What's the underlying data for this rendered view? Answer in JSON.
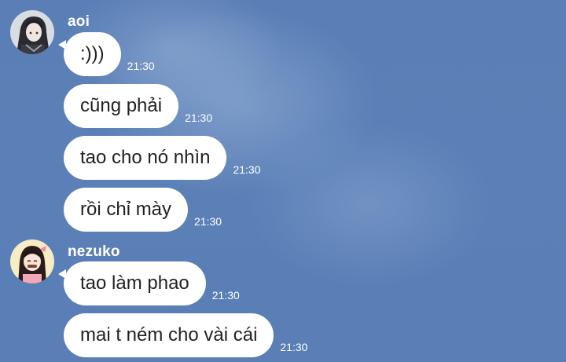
{
  "groups": [
    {
      "sender": "aoi",
      "avatar_icon": "anime-girl-dark-hair-avatar-icon",
      "messages": [
        {
          "text": ":)))",
          "time": "21:30"
        },
        {
          "text": "cũng phải",
          "time": "21:30"
        },
        {
          "text": "tao cho nó nhìn",
          "time": "21:30"
        },
        {
          "text": "rồi chỉ mày",
          "time": "21:30"
        }
      ]
    },
    {
      "sender": "nezuko",
      "avatar_icon": "nezuko-anime-avatar-icon",
      "messages": [
        {
          "text": "tao làm phao",
          "time": "21:30"
        },
        {
          "text": "mai t ném cho vài cái",
          "time": "21:30"
        }
      ]
    }
  ],
  "colors": {
    "background": "#5b80b7",
    "bubble": "#ffffff",
    "bubble_text": "#222222",
    "meta_text": "#ffffff"
  }
}
